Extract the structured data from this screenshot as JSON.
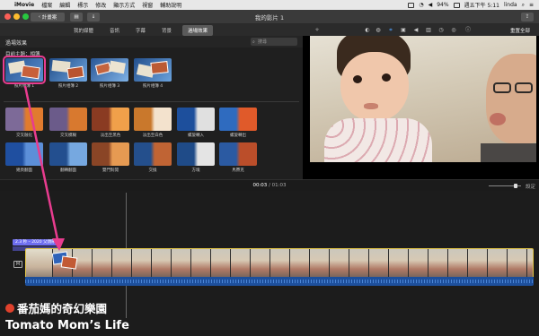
{
  "menubar": {
    "apple_icon": "apple-icon",
    "app_name": "iMovie",
    "items": [
      "檔案",
      "編輯",
      "標示",
      "修改",
      "顯示方式",
      "視窗",
      "輔助說明"
    ],
    "battery": "94%",
    "clock": "週五下午 5:11",
    "user": "linda"
  },
  "titlebar": {
    "back_label": "計畫案",
    "window_title": "我的影片 1"
  },
  "browser": {
    "tabs": [
      "我的媒體",
      "音訊",
      "字幕",
      "背景",
      "過場效果"
    ],
    "active_tab_index": 4,
    "header_title": "過場效果",
    "search_placeholder": "搜尋",
    "theme_section_label": "目前主題：相簿",
    "theme_items": [
      "照片相簿 1",
      "照片相簿 2",
      "照片相簿 3",
      "照片相簿 4"
    ],
    "grid_items": [
      [
        "交叉融化",
        "交叉模糊",
        "淡出至黑色",
        "淡出至白色",
        "螺旋轉入",
        "螺旋轉出"
      ],
      [
        "幾頁翻面",
        "翻轉翻面",
        "雙門對開",
        "交換",
        "方塊",
        "馬賽克"
      ]
    ]
  },
  "viewer": {
    "reset_label": "重置全部"
  },
  "playback": {
    "current_time": "00:03",
    "total_time": "01:03",
    "separator": "/",
    "settings_label": "設定"
  },
  "timeline": {
    "title_clip_label": "2.3 秒 – 2020 父親節"
  },
  "watermark": {
    "line1": "番茄媽的奇幻樂園",
    "line2": "Tomato Mom’s Life"
  },
  "colors": {
    "highlight": "#e83c8f",
    "clip_border": "#e5c847",
    "audio": "#1d4f9c",
    "title_clip": "#6e6ef0"
  }
}
